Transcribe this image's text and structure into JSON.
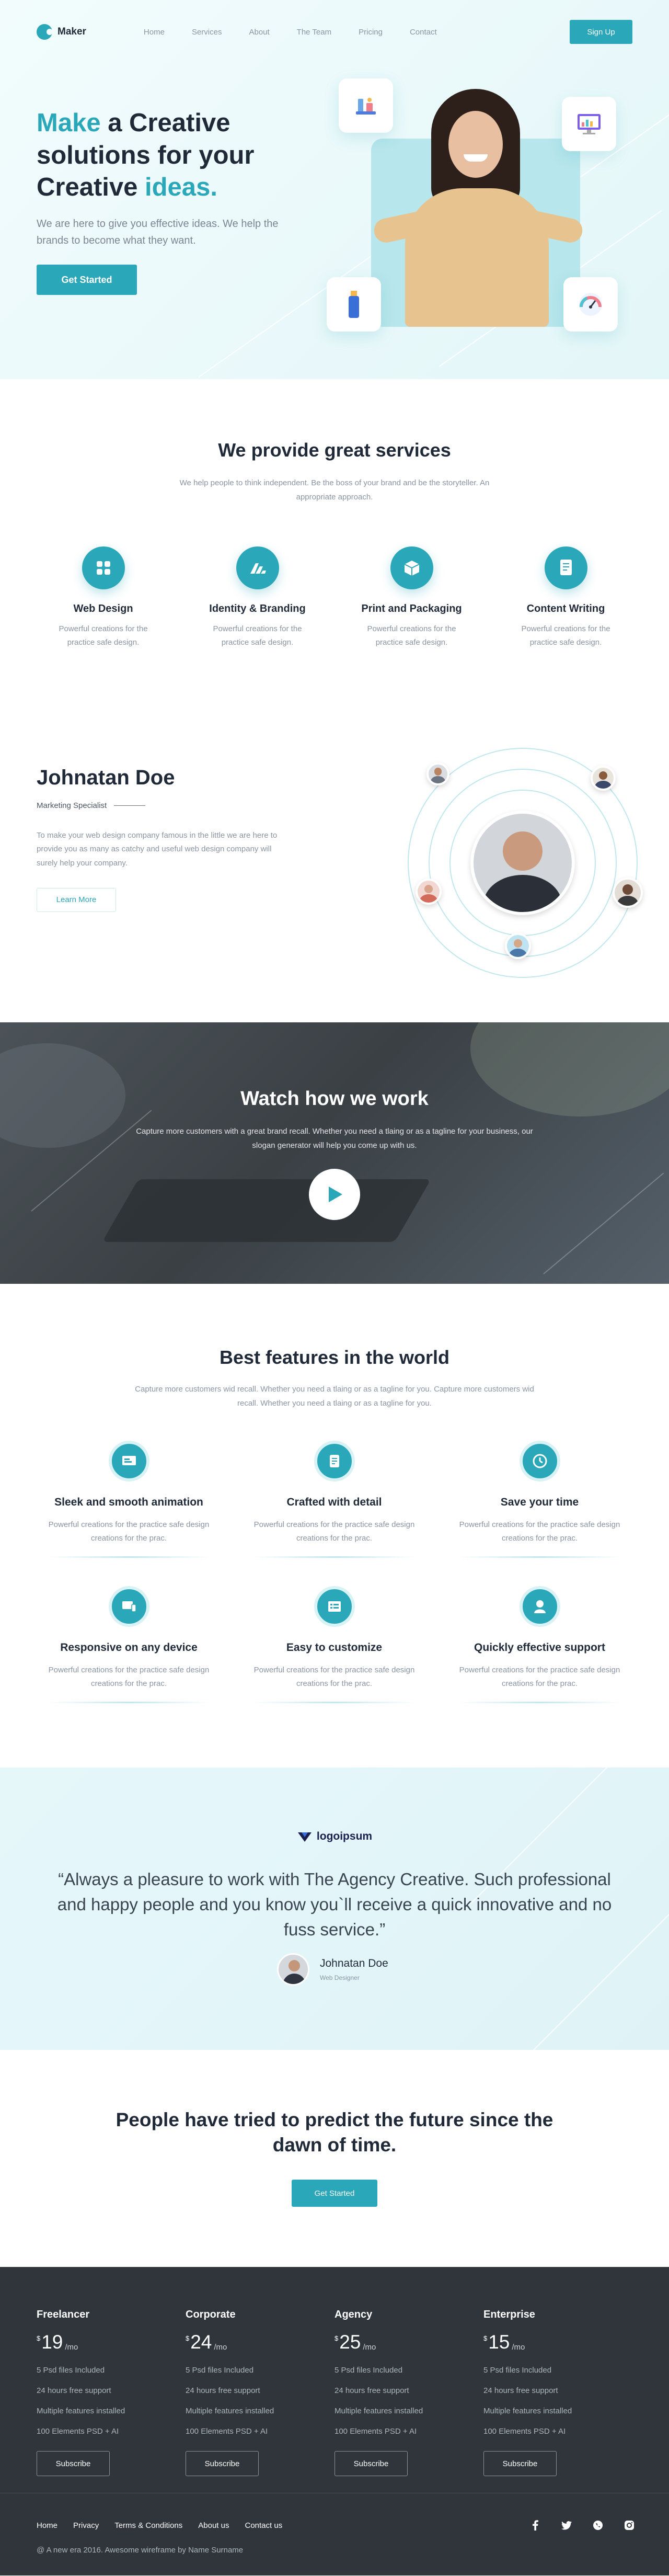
{
  "nav": {
    "logo_text": "Maker",
    "links": [
      "Home",
      "Services",
      "About",
      "The Team",
      "Pricing",
      "Contact"
    ],
    "signup_label": "Sign Up"
  },
  "hero": {
    "title_make": "Make",
    "title_mid": " a Creative solutions for your Creative ",
    "title_ideas": "ideas.",
    "subtitle": "We are here to give you effective ideas. We help the brands to become what they want.",
    "cta_label": "Get Started"
  },
  "services": {
    "title": "We provide great services",
    "subtitle": "We help people to think independent. Be the boss of your brand and be the storyteller. An appropriate approach.",
    "items": [
      {
        "title": "Web Design",
        "desc": "Powerful creations for the practice safe design."
      },
      {
        "title": "Identity & Branding",
        "desc": "Powerful creations for the practice safe design."
      },
      {
        "title": "Print and Packaging",
        "desc": "Powerful creations for the practice safe design."
      },
      {
        "title": "Content Writing",
        "desc": "Powerful creations for the practice safe design."
      }
    ]
  },
  "team": {
    "name": "Johnatan Doe",
    "role": "Marketing Specialist",
    "desc": "To make your web design company famous in the little we are here to provide you as many as catchy and useful web design company will surely help your company.",
    "button_label": "Learn More"
  },
  "video": {
    "title": "Watch how we work",
    "subtitle": "Capture more customers with a great brand recall. Whether you need a tlaing or as a tagline for your business, our slogan generator will help you come up with us."
  },
  "features": {
    "title": "Best features in the world",
    "subtitle": "Capture more customers wid recall. Whether you need a tlaing or as a tagline for you. Capture more customers wid recall. Whether you need a tlaing or as a tagline for you.",
    "items": [
      {
        "title": "Sleek and smooth animation",
        "desc": "Powerful creations for the practice safe design creations for the prac."
      },
      {
        "title": "Crafted with detail",
        "desc": "Powerful creations for the practice safe design creations for the prac."
      },
      {
        "title": "Save your time",
        "desc": "Powerful creations for the practice safe design creations for the prac."
      },
      {
        "title": "Responsive on any device",
        "desc": "Powerful creations for the practice safe design creations for the prac."
      },
      {
        "title": "Easy to customize",
        "desc": "Powerful creations for the practice safe design creations for the prac."
      },
      {
        "title": "Quickly effective support",
        "desc": "Powerful creations for the practice safe design creations for the prac."
      }
    ]
  },
  "testimonial": {
    "brand": "logoipsum",
    "quote": "“Always a pleasure to work with The Agency Creative. Such professional and happy people and you know you`ll receive a quick innovative and no fuss service.”",
    "author_name": "Johnatan Doe",
    "author_role": "Web Designer"
  },
  "cta": {
    "title": "People have tried to predict the future since the dawn of time.",
    "button_label": "Get Started"
  },
  "pricing": {
    "currency": "$",
    "per": "/mo",
    "subscribe_label": "Subscribe",
    "plans": [
      {
        "name": "Freelancer",
        "price": "19",
        "features": [
          "5 Psd files Included",
          "24 hours free support",
          "Multiple features installed",
          "100 Elements PSD + AI"
        ]
      },
      {
        "name": "Corporate",
        "price": "24",
        "features": [
          "5 Psd files Included",
          "24 hours free support",
          "Multiple features installed",
          "100 Elements PSD + AI"
        ]
      },
      {
        "name": "Agency",
        "price": "25",
        "features": [
          "5 Psd files Included",
          "24 hours free support",
          "Multiple features installed",
          "100 Elements PSD + AI"
        ]
      },
      {
        "name": "Enterprise",
        "price": "15",
        "features": [
          "5 Psd files Included",
          "24 hours free support",
          "Multiple features installed",
          "100 Elements PSD + AI"
        ]
      }
    ]
  },
  "footer": {
    "links": [
      "Home",
      "Privacy",
      "Terms & Conditions",
      "About us",
      "Contact us"
    ],
    "socials": [
      "facebook-icon",
      "twitter-icon",
      "whatsapp-icon",
      "instagram-icon"
    ],
    "copyright": "@ A new era 2016. Awesome wireframe by Name Surname"
  },
  "colors": {
    "accent": "#2aa7b8",
    "dark": "#1f2937",
    "footer_bg": "#2f353b",
    "hero_bg": "#e3f6f8"
  }
}
